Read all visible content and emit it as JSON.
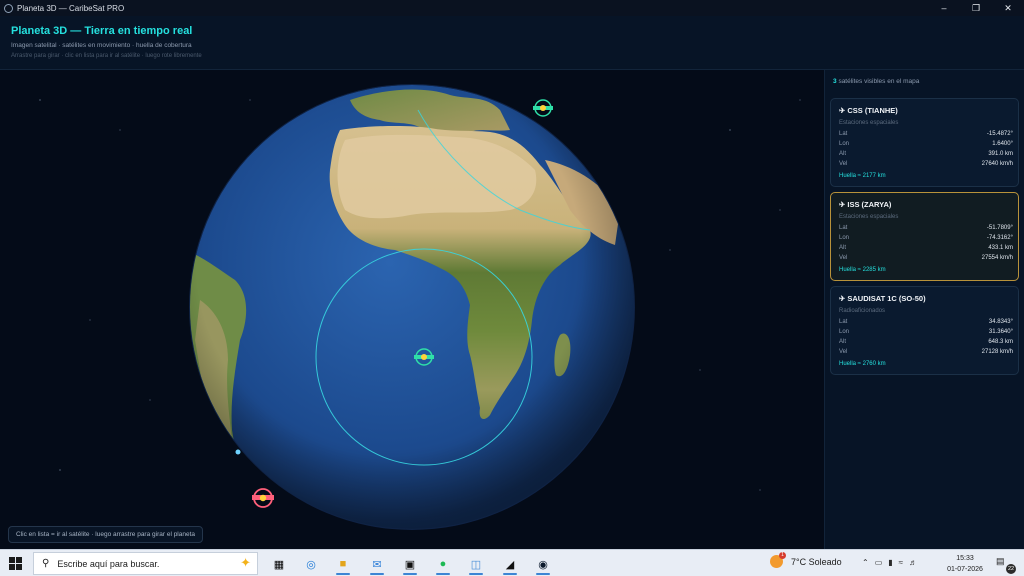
{
  "window": {
    "title": "Planeta 3D — CaribeSat PRO",
    "minimize_icon": "minimize-icon",
    "maximize_icon": "restore-icon",
    "close_icon": "close-icon"
  },
  "header": {
    "title": "Planeta 3D — Tierra en tiempo real",
    "subtitle": "Imagen satelital · satélites en movimiento · huella de cobertura",
    "hint": "Arrastre para girar · clic en lista para ir al satélite · luego rote libremente"
  },
  "map": {
    "bottom_hint": "Clic en lista = ir al satélite · luego arrastre para girar el planeta",
    "colors": {
      "ocean": "#1c4a8e",
      "land": "#8a9a4c",
      "desert": "#d9c08a",
      "coverage": "#37d6e0"
    }
  },
  "panel": {
    "count_number": "3",
    "count_label": "satélites visibles en el mapa",
    "satellites": [
      {
        "name": "CSS (TIANHE)",
        "category": "Estaciones espaciales",
        "lat_label": "Lat",
        "lat": "-15.4872°",
        "lon_label": "Lon",
        "lon": "1.6400°",
        "alt_label": "Alt",
        "alt": "391.0 km",
        "vel_label": "Vel",
        "vel": "27640 km/h",
        "footprint": "Huella ≈ 2177 km",
        "selected": false
      },
      {
        "name": "ISS (ZARYA)",
        "category": "Estaciones espaciales",
        "lat_label": "Lat",
        "lat": "-51.7809°",
        "lon_label": "Lon",
        "lon": "-74.3162°",
        "alt_label": "Alt",
        "alt": "433.1 km",
        "vel_label": "Vel",
        "vel": "27554 km/h",
        "footprint": "Huella ≈ 2285 km",
        "selected": true
      },
      {
        "name": "SAUDISAT 1C (SO-50)",
        "category": "Radioaficionados",
        "lat_label": "Lat",
        "lat": "34.8343°",
        "lon_label": "Lon",
        "lon": "31.3640°",
        "alt_label": "Alt",
        "alt": "648.3 km",
        "vel_label": "Vel",
        "vel": "27128 km/h",
        "footprint": "Huella ≈ 2760 km",
        "selected": false
      }
    ]
  },
  "taskbar": {
    "search_placeholder": "Escribe aquí para buscar.",
    "weather": "7°C Soleado",
    "weather_badge": "1",
    "time": "15:33",
    "date": "01-07-2026",
    "notifications": "22"
  }
}
